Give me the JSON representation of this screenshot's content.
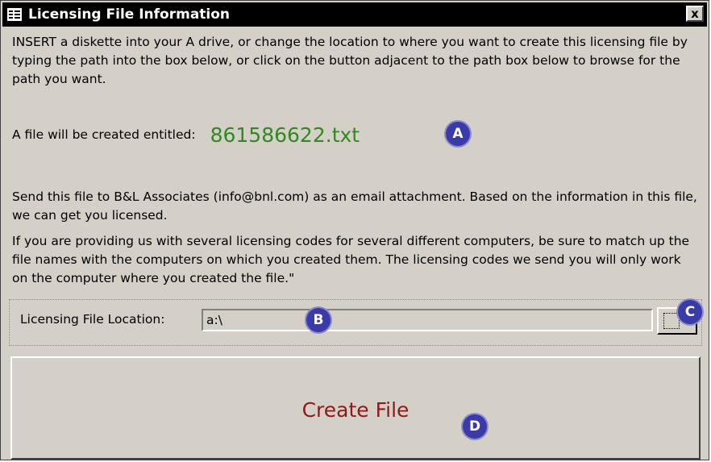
{
  "window": {
    "title": "Licensing File Information",
    "close_label": "x",
    "colors": {
      "titlebar": "#000000",
      "face": "#d4d0c8",
      "filename": "#2f8a1f",
      "button_text": "#8b1a1a",
      "callout": "#3a3aa8"
    }
  },
  "instructions": {
    "paragraph_1": "INSERT a diskette into your A drive, or change the location to where you want to create this licensing file by typing the path into the box below, or click on the button adjacent to the path box below to browse for the path you want.",
    "file_label": "A file will be created entitled:",
    "file_name": "861586622.txt",
    "paragraph_2": "Send this file to B&L Associates (info@bnl.com) as an email attachment. Based on the information in this file, we can get you licensed.",
    "paragraph_3": "If you are providing us with several licensing codes for several different computers, be sure to match up the file names with the computers on which you created them. The licensing codes we send you will only work on the computer where you created the file.\""
  },
  "location": {
    "label": "Licensing File Location:",
    "value": "a:\\",
    "browse_icon": "browse-button-icon"
  },
  "actions": {
    "create_label": "Create File"
  },
  "callouts": {
    "a": "A",
    "b": "B",
    "c": "C",
    "d": "D"
  }
}
